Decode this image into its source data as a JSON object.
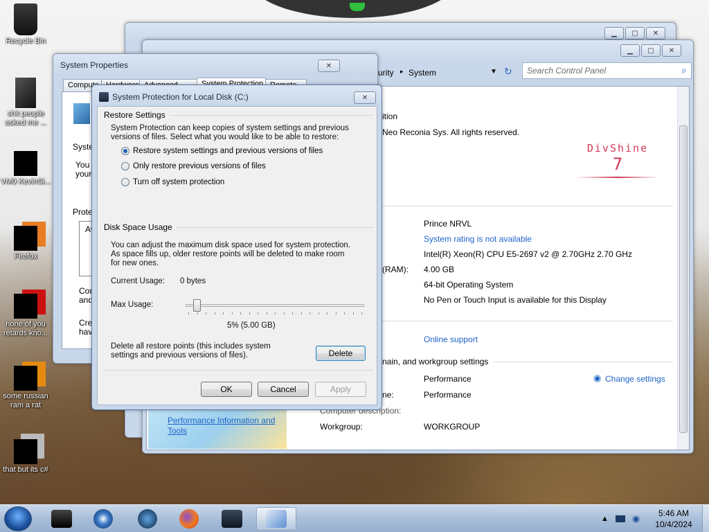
{
  "desktop": {
    "icons": [
      {
        "label": "Recycle Bin",
        "icon": "recycle-bin-icon"
      },
      {
        "label": "shit people asked me ...",
        "icon": "folder-icon"
      },
      {
        "label": "VM0 KevinSi...",
        "icon": "vm-icon"
      },
      {
        "label": "Firefox",
        "icon": "firefox-icon"
      },
      {
        "label": "none of you retards kno...",
        "icon": "app-icon"
      },
      {
        "label": "some russian ram a rat",
        "icon": "app-icon"
      },
      {
        "label": "that but its c#",
        "icon": "app-icon"
      }
    ]
  },
  "control_panel": {
    "breadcrumb_partial": "urity",
    "breadcrumb_sep": "▸",
    "breadcrumb_current": "System",
    "search_placeholder": "Search Control Panel",
    "edition_partial": "ition",
    "copyright_partial": "Neo Reconia Sys.  All rights reserved.",
    "logo_brand": "DivShine",
    "logo_version": "7",
    "rows": [
      {
        "label": "",
        "value": "Prince NRVL"
      },
      {
        "label": "",
        "value": "System rating is not available",
        "link": true
      },
      {
        "label": "",
        "value": "Intel(R) Xeon(R) CPU E5-2697 v2 @ 2.70GHz   2.70 GHz"
      },
      {
        "label": "(RAM):",
        "value": "4.00 GB"
      },
      {
        "label": "",
        "value": "64-bit Operating System"
      },
      {
        "label": "",
        "value": "No Pen or Touch Input is available for this Display"
      }
    ],
    "online_support": "Online support",
    "section_partial": "nain, and workgroup settings",
    "computer_name": "Performance",
    "change_settings": "Change settings",
    "full_name_label_partial": "ne:",
    "full_name": "Performance",
    "description_label_partial": "Computer description:",
    "workgroup_label": "Workgroup:",
    "workgroup": "WORKGROUP",
    "see_also_link": "Performance Information and Tools"
  },
  "system_properties": {
    "title": "System Properties",
    "tabs": [
      "Compute",
      "Hardware",
      "Advanced",
      "System Protection",
      "Remote"
    ],
    "text_sys": "Syste",
    "text_you": "You c",
    "text_your": "your",
    "text_prot": "Protec",
    "text_av": "Av",
    "text_con": "Con",
    "text_and": "and",
    "text_crea": "Crea",
    "text_hav": "hav"
  },
  "dialog": {
    "title": "System Protection for Local Disk (C:)",
    "restore_group": "Restore Settings",
    "restore_desc": "System Protection can keep copies of system settings and previous versions of files. Select what you would like to be able to restore:",
    "options": [
      {
        "label": "Restore system settings and previous versions of files",
        "checked": true
      },
      {
        "label": "Only restore previous versions of files",
        "checked": false
      },
      {
        "label": "Turn off system protection",
        "checked": false
      }
    ],
    "disk_group": "Disk Space Usage",
    "disk_desc": "You can adjust the maximum disk space used for system protection. As space fills up, older restore points will be deleted to make room for new ones.",
    "current_usage_label": "Current Usage:",
    "current_usage_value": "0 bytes",
    "max_usage_label": "Max Usage:",
    "max_usage_fraction": 0.05,
    "max_usage_value": "5% (5.00 GB)",
    "delete_desc": "Delete all restore points (this includes system settings and previous versions of files).",
    "delete_label": "Delete",
    "ok_label": "OK",
    "cancel_label": "Cancel",
    "apply_label": "Apply"
  },
  "taskbar": {
    "items": [
      "app-icon",
      "media-player-icon",
      "browser-icon",
      "firefox-icon",
      "monitor-icon",
      "control-panel-icon"
    ],
    "time": "5:46 AM",
    "date": "10/4/2024"
  }
}
